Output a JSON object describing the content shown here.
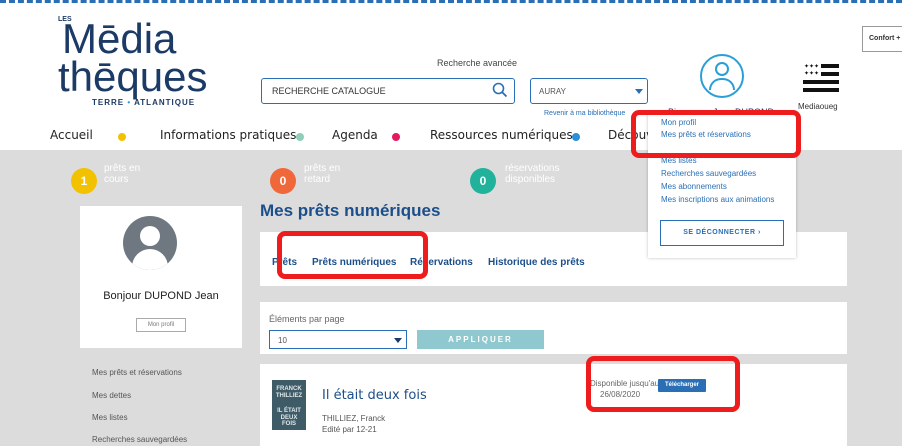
{
  "logo": {
    "prefix": "LES",
    "line1": "Mēdia",
    "line2": "thēques",
    "sub_left": "TERRE",
    "sub_right": "ATLANTIQUE"
  },
  "search": {
    "advanced_label": "Recherche avancée",
    "value": "RECHERCHE CATALOGUE",
    "library_value": "AURAY",
    "back_link": "Revenir à ma bibliothèque"
  },
  "user": {
    "welcome": "Bienvenue Jean DUPOND"
  },
  "flag_label": "Mediaoueg",
  "comfort_label": "Confort +",
  "nav": {
    "items": [
      {
        "label": "Accueil",
        "dot_color": "#f2c100"
      },
      {
        "label": "Informations pratiques",
        "dot_color": "#8fcfb9"
      },
      {
        "label": "Agenda",
        "dot_color": "#e5195e"
      },
      {
        "label": "Ressources numériques",
        "dot_color": "#2a8fd6"
      },
      {
        "label": "Découvrir"
      }
    ]
  },
  "stats": [
    {
      "count": "1",
      "line1": "prêts en",
      "line2": "cours",
      "color": "#f2c100"
    },
    {
      "count": "0",
      "line1": "prêts en",
      "line2": "retard",
      "color": "#f0673a"
    },
    {
      "count": "0",
      "line1": "réservations",
      "line2": "disponibles",
      "color": "#21b29b"
    }
  ],
  "sidebar": {
    "greeting": "Bonjour DUPOND Jean",
    "profile_button": "Mon profil",
    "links": [
      "Mes prêts et réservations",
      "Mes dettes",
      "Mes listes",
      "Recherches sauvegardées"
    ]
  },
  "main": {
    "title": "Mes prêts numériques",
    "tabs": [
      "Prêts",
      "Prêts numériques",
      "Réservations",
      "Historique des prêts"
    ],
    "per_page_label": "Éléments par page",
    "per_page_value": "10",
    "apply_label": "APPLIQUER"
  },
  "loan": {
    "cover_lines": [
      "FRANCK",
      "THILLIEZ",
      "IL ÉTAIT",
      "DEUX FOIS"
    ],
    "title": "Il était deux fois",
    "author": "THILLIEZ, Franck",
    "edition": "Edité par 12-21",
    "availability_line1": "Disponible jusqu'au",
    "availability_line2": "26/08/2020",
    "download_label": "Télécharger"
  },
  "dropdown": {
    "items": [
      "Mon profil",
      "Mes prêts et réservations",
      "Mes listes",
      "Recherches sauvegardées",
      "Mes abonnements",
      "Mes inscriptions aux animations"
    ],
    "logout": "SE DÉCONNECTER ›"
  },
  "colors": {
    "brand_blue": "#1c4f8a",
    "link_blue": "#2a6fb5",
    "highlight_red": "#ee1c1c",
    "content_grey": "#dcdcdc"
  }
}
